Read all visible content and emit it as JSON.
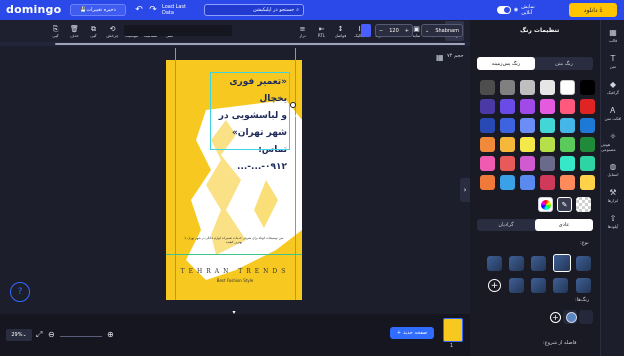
{
  "app": {
    "logo": "domingo"
  },
  "topbar": {
    "save_label": "ذخیره تغییرات",
    "save_icon": "save-icon",
    "undo_icon": "↶",
    "redo_icon": "↷",
    "load_label": "Load Last Data",
    "search_label": "جستجو در اپلیکیشن",
    "toggle_label": "نمایش آنلاین",
    "download_label": "دانلود"
  },
  "toolbar": {
    "font": "Shabnam",
    "size": "120",
    "minus": "−",
    "plus": "+",
    "tools": [
      {
        "label": "رنگ",
        "icon": "A"
      },
      {
        "label": "حاشیه",
        "icon": "A"
      },
      {
        "label": "سایه",
        "icon": "▣"
      },
      {
        "label": "افکت",
        "icon": "✦"
      },
      {
        "label": "بولد",
        "icon": "B"
      },
      {
        "label": "ایتالیک",
        "icon": "I"
      },
      {
        "label": "فواصل",
        "icon": "↕"
      },
      {
        "label": "RTL",
        "icon": "⇤"
      },
      {
        "label": "تراز",
        "icon": "≡"
      },
      {
        "label": "",
        "icon": ""
      },
      {
        "label": "",
        "icon": ""
      },
      {
        "label": "",
        "icon": ""
      },
      {
        "label": "",
        "icon": ""
      },
      {
        "label": "",
        "icon": ""
      },
      {
        "label": "",
        "icon": ""
      },
      {
        "label": "قفل",
        "icon": "🔒"
      },
      {
        "label": "شفافیت",
        "icon": "◐"
      },
      {
        "label": "موقعیت",
        "icon": "✥"
      },
      {
        "label": "چرخش",
        "icon": "⟲"
      },
      {
        "label": "کپی",
        "icon": "⧉"
      },
      {
        "label": "حذف",
        "icon": "🗑"
      },
      {
        "label": "کپی",
        "icon": "⎘"
      }
    ]
  },
  "canvas": {
    "label": "حجم ۷۴",
    "poster_lines": [
      "«تعمیر فوری یخچال",
      "و لباسشویی در",
      "شهر تهران»",
      "تماس: ۰۹۱۲-...-..."
    ],
    "fine_print": "متن توضیحات کوتاه برای معرفی خدمات تعمیرات لوازم خانگی در شهر تهران با بهترین کیفیت",
    "brand": "TEHRAN TRENDS",
    "tagline": "Best Fashion Style"
  },
  "bottombar": {
    "zoom": "29%",
    "new_page_label": "صفحه جدید",
    "page_number": "1",
    "collapse_icon": "▾"
  },
  "panel": {
    "title": "تنظیمات رنگ",
    "tab_bg": "رنگ پس‌زمینه",
    "tab_text": "رنگ متن",
    "mode_solid": "عادی",
    "mode_gradient": "گرادیان",
    "label_type": "نوع:",
    "label_stops": "رنگ‌ها:",
    "label_distance": "فاصله از شروع:",
    "swatches": [
      "#000000",
      "#ffffff",
      "#e6e6e6",
      "#bfbfbf",
      "#808080",
      "#4d4d4d",
      "#e02424",
      "#ff5a7d",
      "#e55be0",
      "#a04be8",
      "#6b4be8",
      "#4b3aa5",
      "#1e78d6",
      "#45b6e8",
      "#43d6d6",
      "#6a8ef5",
      "#3e63e0",
      "#2849b3",
      "#1f8a3a",
      "#5acb5a",
      "#b6e04a",
      "#f5e94a",
      "#f5b83a",
      "#f08a3a",
      "#2fd4a4",
      "#37e8c8",
      "#6a6a8a",
      "#d05ad0",
      "#e85a5a",
      "#f05ab0",
      "#ffd24a",
      "#ff8a5a",
      "#d03a5a",
      "#5a8af0",
      "#3aa0e8",
      "#f07a3a"
    ]
  }
}
